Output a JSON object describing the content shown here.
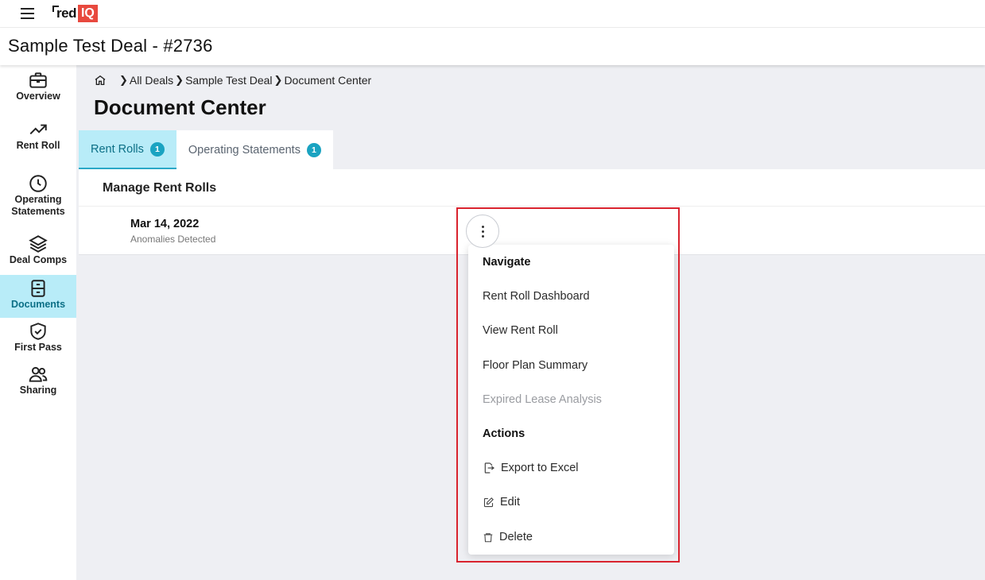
{
  "app": {
    "logo_text": "red",
    "logo_badge": "IQ"
  },
  "header": {
    "title": "Sample Test Deal - #2736"
  },
  "sidebar": {
    "items": [
      {
        "label": "Overview",
        "icon": "briefcase-icon"
      },
      {
        "label": "Rent Roll",
        "icon": "trending-up-icon"
      },
      {
        "label_line1": "Operating",
        "label_line2": "Statements",
        "icon": "clock-icon"
      },
      {
        "label": "Deal Comps",
        "icon": "layers-icon"
      },
      {
        "label": "Documents",
        "icon": "archive-icon",
        "active": true
      },
      {
        "label": "First Pass",
        "icon": "shield-check-icon"
      },
      {
        "label": "Sharing",
        "icon": "users-icon"
      }
    ]
  },
  "breadcrumb": {
    "items": [
      "All Deals",
      "Sample Test Deal",
      "Document Center"
    ]
  },
  "page": {
    "title": "Document Center"
  },
  "tabs": [
    {
      "label": "Rent Rolls",
      "count": "1",
      "active": true
    },
    {
      "label": "Operating Statements",
      "count": "1",
      "active": false
    }
  ],
  "panel": {
    "title": "Manage Rent Rolls",
    "rows": [
      {
        "date": "Mar 14, 2022",
        "status": "Anomalies Detected"
      }
    ]
  },
  "menu": {
    "navigate_header": "Navigate",
    "navigate_items": [
      "Rent Roll Dashboard",
      "View Rent Roll",
      "Floor Plan Summary",
      "Expired Lease Analysis"
    ],
    "actions_header": "Actions",
    "action_items": [
      "Export to Excel",
      "Edit",
      "Delete"
    ]
  },
  "colors": {
    "accent": "#1aa3c1",
    "active_bg": "#b8ecf8",
    "brand_red": "#e8493e",
    "highlight": "#d9232e"
  }
}
